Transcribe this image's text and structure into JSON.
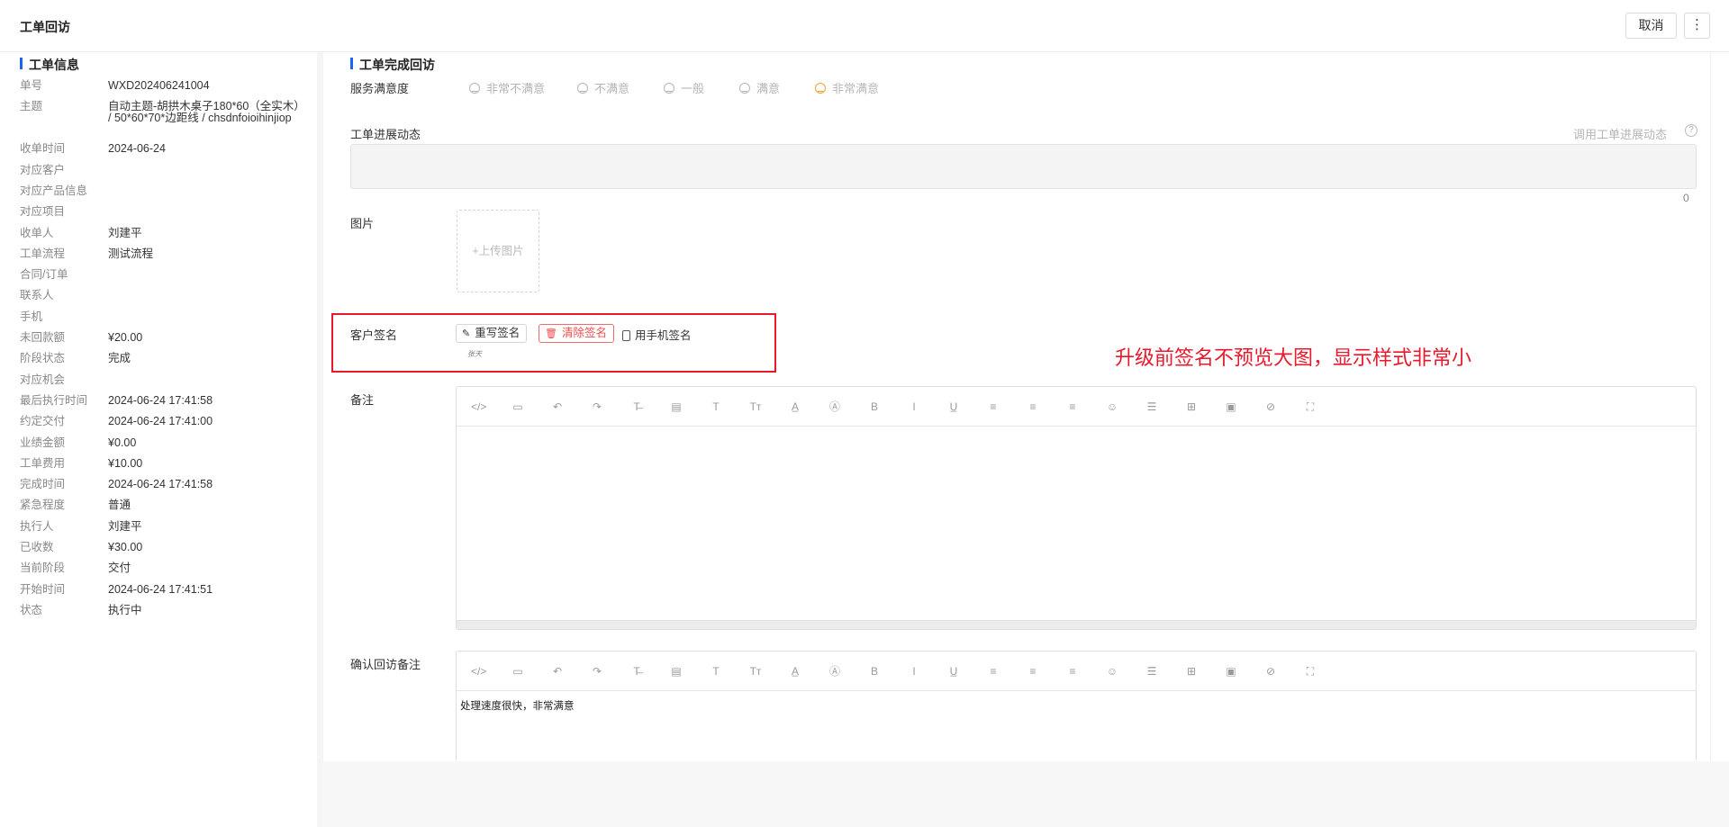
{
  "header": {
    "title": "工单回访",
    "cancel_label": "取消",
    "more_icon": "⋮"
  },
  "left_panel": {
    "section_title": "工单信息",
    "fields": [
      {
        "key": "单号",
        "value": "WXD202406241004"
      },
      {
        "key": "主题",
        "value": "自动主题-胡拱木桌子180*60（全实木） / 50*60*70*边距线 / chsdnfoioihinjiop"
      },
      {
        "key": "收单时间",
        "value": "2024-06-24"
      },
      {
        "key": "对应客户",
        "value": ""
      },
      {
        "key": "对应产品信息",
        "value": ""
      },
      {
        "key": "对应项目",
        "value": ""
      },
      {
        "key": "收单人",
        "value": "刘建平"
      },
      {
        "key": "工单流程",
        "value": "测试流程"
      },
      {
        "key": "合同/订单",
        "value": ""
      },
      {
        "key": "联系人",
        "value": ""
      },
      {
        "key": "手机",
        "value": ""
      },
      {
        "key": "未回款额",
        "value": "¥20.00"
      },
      {
        "key": "阶段状态",
        "value": "完成"
      },
      {
        "key": "对应机会",
        "value": ""
      },
      {
        "key": "最后执行时间",
        "value": "2024-06-24 17:41:58"
      },
      {
        "key": "约定交付",
        "value": "2024-06-24 17:41:00"
      },
      {
        "key": "业绩金额",
        "value": "¥0.00"
      },
      {
        "key": "工单费用",
        "value": "¥10.00"
      },
      {
        "key": "完成时间",
        "value": "2024-06-24 17:41:58"
      },
      {
        "key": "紧急程度",
        "value": "普通"
      },
      {
        "key": "执行人",
        "value": "刘建平"
      },
      {
        "key": "已收数",
        "value": "¥30.00"
      },
      {
        "key": "当前阶段",
        "value": "交付"
      },
      {
        "key": "开始时间",
        "value": "2024-06-24 17:41:51"
      },
      {
        "key": "状态",
        "value": "执行中"
      }
    ]
  },
  "right_panel": {
    "section_title": "工单完成回访",
    "satisfaction": {
      "label": "服务满意度",
      "options": [
        "非常不满意",
        "不满意",
        "一般",
        "满意",
        "非常满意"
      ],
      "selected": "非常满意",
      "selected_color": "#f5a033"
    },
    "progress": {
      "label": "工单进展动态",
      "link_label": "调用工单进展动态",
      "help_icon": "?",
      "value": "",
      "char_count": "0"
    },
    "images": {
      "label": "图片",
      "upload_label": "+上传图片"
    },
    "signature": {
      "label": "客户签名",
      "rewrite_label": "重写签名",
      "clear_label": "清除签名",
      "mobile_label": "用手机签名",
      "preview_text": "张天"
    },
    "annotation": {
      "text": "升级前签名不预览大图，显示样式非常小",
      "color": "#e8192c"
    },
    "remark": {
      "label": "备注",
      "content": ""
    },
    "confirm_remark": {
      "label": "确认回访备注",
      "content": "处理速度很快，非常满意"
    },
    "toolbar_icons": [
      "code-icon",
      "template-icon",
      "undo-icon",
      "redo-icon",
      "strikethrough-icon",
      "paste-icon",
      "text-icon",
      "font-size-icon",
      "font-color-icon",
      "background-color-icon",
      "bold-icon",
      "italic-icon",
      "underline-icon",
      "align-left-icon",
      "align-center-icon",
      "align-right-icon",
      "emoji-icon",
      "horizontal-line-icon",
      "table-icon",
      "image-icon",
      "attachment-icon",
      "fullscreen-icon"
    ]
  }
}
